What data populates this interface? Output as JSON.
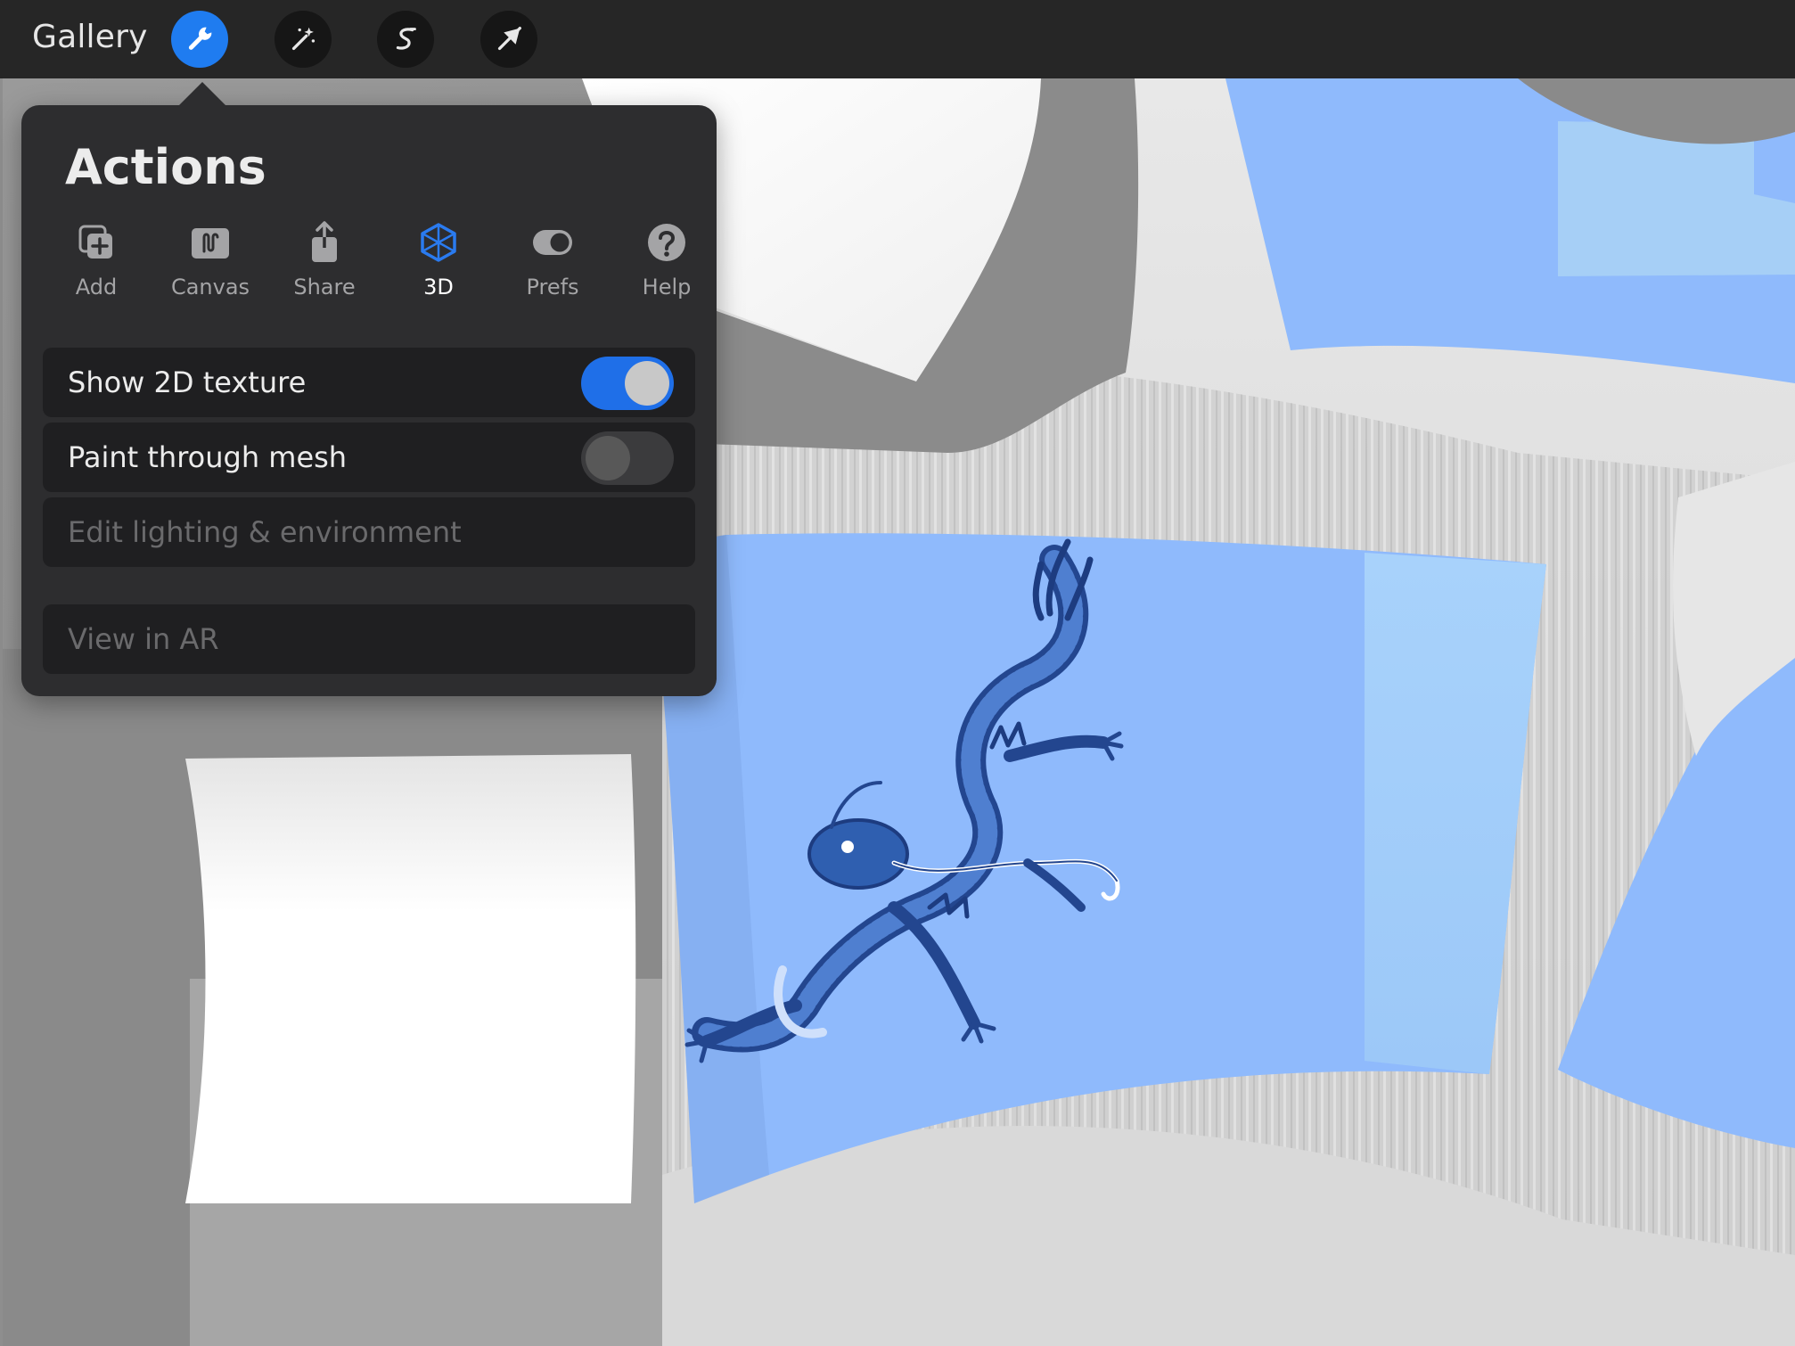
{
  "toolbar": {
    "gallery_label": "Gallery",
    "tools": [
      {
        "name": "wrench-icon",
        "active": true
      },
      {
        "name": "magic-wand-icon",
        "active": false
      },
      {
        "name": "selection-icon",
        "active": false
      },
      {
        "name": "transform-arrow-icon",
        "active": false
      }
    ]
  },
  "actions_panel": {
    "title": "Actions",
    "tabs": [
      {
        "label": "Add",
        "icon": "add-layer-icon"
      },
      {
        "label": "Canvas",
        "icon": "canvas-icon"
      },
      {
        "label": "Share",
        "icon": "share-icon"
      },
      {
        "label": "3D",
        "icon": "cube-3d-icon",
        "active": true
      },
      {
        "label": "Prefs",
        "icon": "toggle-prefs-icon"
      },
      {
        "label": "Help",
        "icon": "help-icon"
      }
    ],
    "options": [
      {
        "label": "Show 2D texture",
        "toggle": true,
        "on": true
      },
      {
        "label": "Paint through mesh",
        "toggle": true,
        "on": false
      },
      {
        "label": "Edit lighting & environment",
        "disabled": true
      },
      {
        "label": "View in AR",
        "disabled": true
      }
    ]
  },
  "colors": {
    "accent": "#1f7cf0",
    "texture_blue": "#8fbafc",
    "dragon_blue": "#2f5fb0"
  }
}
